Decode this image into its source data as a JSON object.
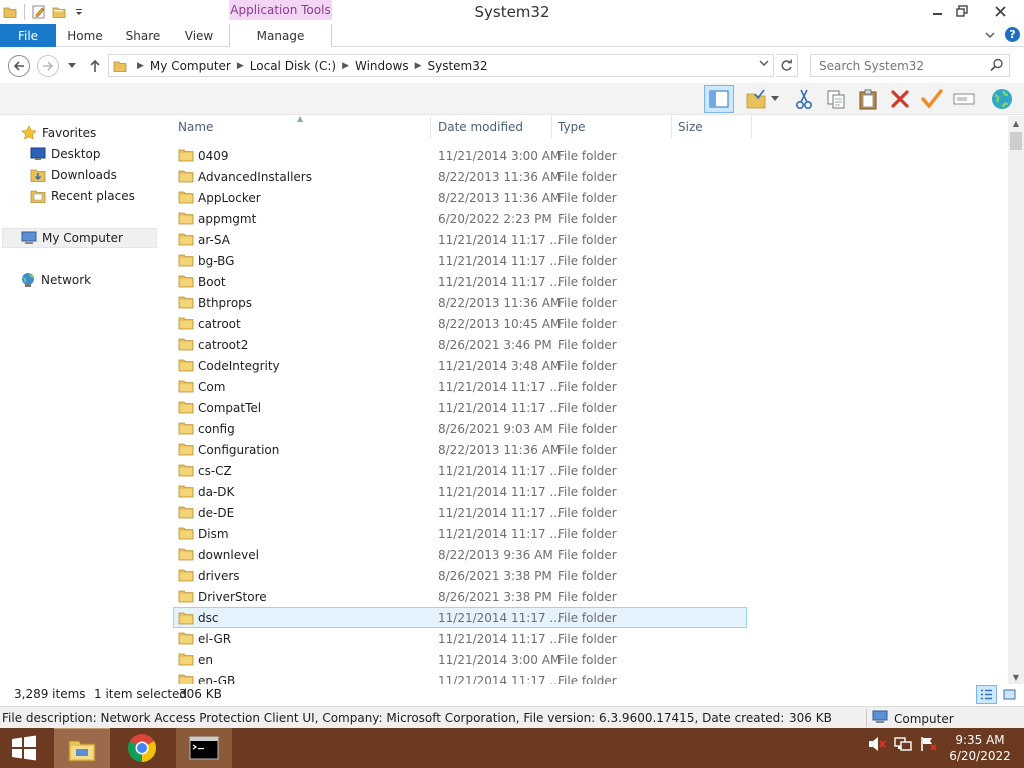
{
  "window": {
    "title": "System32",
    "context_tab_label": "Application Tools"
  },
  "ribbon": {
    "tabs": [
      {
        "label": "File"
      },
      {
        "label": "Home"
      },
      {
        "label": "Share"
      },
      {
        "label": "View"
      },
      {
        "label": "Manage"
      }
    ]
  },
  "address": {
    "breadcrumbs": [
      "My Computer",
      "Local Disk (C:)",
      "Windows",
      "System32"
    ]
  },
  "search": {
    "placeholder": "Search System32"
  },
  "navigation": {
    "favorites": "Favorites",
    "desktop": "Desktop",
    "downloads": "Downloads",
    "recent_places": "Recent places",
    "my_computer": "My Computer",
    "network": "Network"
  },
  "columns": {
    "name": "Name",
    "date_modified": "Date modified",
    "type": "Type",
    "size": "Size"
  },
  "files": [
    {
      "name": "0409",
      "date": "11/21/2014 3:00 AM",
      "type": "File folder"
    },
    {
      "name": "AdvancedInstallers",
      "date": "8/22/2013 11:36 AM",
      "type": "File folder"
    },
    {
      "name": "AppLocker",
      "date": "8/22/2013 11:36 AM",
      "type": "File folder"
    },
    {
      "name": "appmgmt",
      "date": "6/20/2022 2:23 PM",
      "type": "File folder"
    },
    {
      "name": "ar-SA",
      "date": "11/21/2014 11:17 ...",
      "type": "File folder"
    },
    {
      "name": "bg-BG",
      "date": "11/21/2014 11:17 ...",
      "type": "File folder"
    },
    {
      "name": "Boot",
      "date": "11/21/2014 11:17 ...",
      "type": "File folder"
    },
    {
      "name": "Bthprops",
      "date": "8/22/2013 11:36 AM",
      "type": "File folder"
    },
    {
      "name": "catroot",
      "date": "8/22/2013 10:45 AM",
      "type": "File folder"
    },
    {
      "name": "catroot2",
      "date": "8/26/2021 3:46 PM",
      "type": "File folder"
    },
    {
      "name": "CodeIntegrity",
      "date": "11/21/2014 3:48 AM",
      "type": "File folder"
    },
    {
      "name": "Com",
      "date": "11/21/2014 11:17 ...",
      "type": "File folder"
    },
    {
      "name": "CompatTel",
      "date": "11/21/2014 11:17 ...",
      "type": "File folder"
    },
    {
      "name": "config",
      "date": "8/26/2021 9:03 AM",
      "type": "File folder"
    },
    {
      "name": "Configuration",
      "date": "8/22/2013 11:36 AM",
      "type": "File folder"
    },
    {
      "name": "cs-CZ",
      "date": "11/21/2014 11:17 ...",
      "type": "File folder"
    },
    {
      "name": "da-DK",
      "date": "11/21/2014 11:17 ...",
      "type": "File folder"
    },
    {
      "name": "de-DE",
      "date": "11/21/2014 11:17 ...",
      "type": "File folder"
    },
    {
      "name": "Dism",
      "date": "11/21/2014 11:17 ...",
      "type": "File folder"
    },
    {
      "name": "downlevel",
      "date": "8/22/2013 9:36 AM",
      "type": "File folder"
    },
    {
      "name": "drivers",
      "date": "8/26/2021 3:38 PM",
      "type": "File folder"
    },
    {
      "name": "DriverStore",
      "date": "8/26/2021 3:38 PM",
      "type": "File folder"
    },
    {
      "name": "dsc",
      "date": "11/21/2014 11:17 ...",
      "type": "File folder",
      "selected": true
    },
    {
      "name": "el-GR",
      "date": "11/21/2014 11:17 ...",
      "type": "File folder"
    },
    {
      "name": "en",
      "date": "11/21/2014 3:00 AM",
      "type": "File folder"
    },
    {
      "name": "en-GB",
      "date": "11/21/2014 11:17 ...",
      "type": "File folder"
    }
  ],
  "status": {
    "item_count": "3,289 items",
    "selection": "1 item selected",
    "selection_size": "306 KB"
  },
  "details": {
    "text": "File description: Network Access Protection Client UI, Company: Microsoft Corporation, File version: 6.3.9600.17415, Date created: 11/21/2014 4:17 AM",
    "size": "306 KB",
    "zone": "Computer"
  },
  "clock": {
    "time": "9:35 AM",
    "date": "6/20/2022"
  },
  "colors": {
    "file_tab": "#1979ca",
    "context_tab": "#f3d6f5",
    "selection": "#e5f3ff",
    "taskbar": "#6b3a20",
    "folder": "#e8c15a"
  }
}
